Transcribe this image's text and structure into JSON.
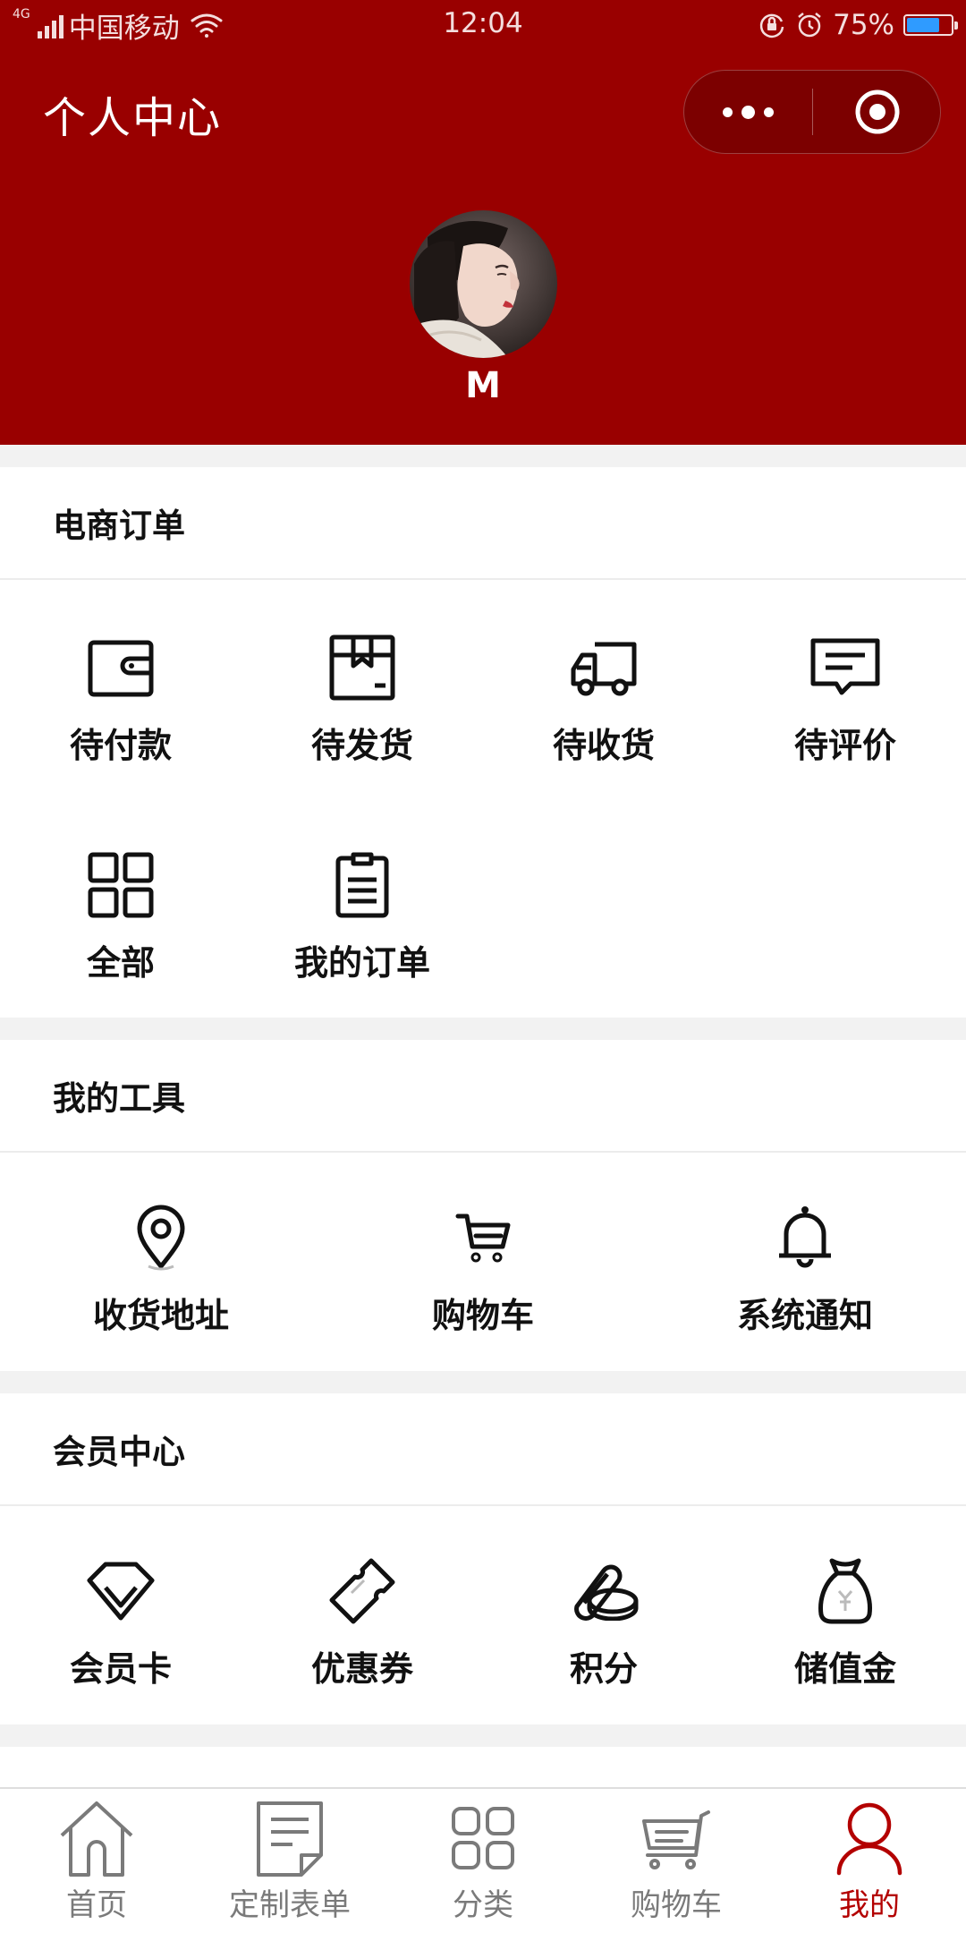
{
  "status_bar": {
    "network": "4G",
    "carrier": "中国移动",
    "time": "12:04",
    "battery": "75%",
    "battery_level": 0.75,
    "battery_color": "#2f9bff"
  },
  "header": {
    "title": "个人中心",
    "username": "M",
    "background_color": "#990000",
    "more_icon": "more-dots-icon",
    "close_icon": "target-circle-icon"
  },
  "orders": {
    "title": "电商订单",
    "items": [
      {
        "label": "待付款",
        "icon": "wallet-icon"
      },
      {
        "label": "待发货",
        "icon": "package-box-icon"
      },
      {
        "label": "待收货",
        "icon": "delivery-truck-icon"
      },
      {
        "label": "待评价",
        "icon": "comment-icon"
      },
      {
        "label": "全部",
        "icon": "grid-icon"
      },
      {
        "label": "我的订单",
        "icon": "clipboard-list-icon"
      }
    ]
  },
  "tools": {
    "title": "我的工具",
    "items": [
      {
        "label": "收货地址",
        "icon": "location-pin-icon"
      },
      {
        "label": "购物车",
        "icon": "shopping-cart-icon"
      },
      {
        "label": "系统通知",
        "icon": "bell-icon"
      }
    ]
  },
  "member": {
    "title": "会员中心",
    "items": [
      {
        "label": "会员卡",
        "icon": "diamond-icon"
      },
      {
        "label": "优惠券",
        "icon": "coupon-ticket-icon"
      },
      {
        "label": "积分",
        "icon": "coins-icon"
      },
      {
        "label": "储值金",
        "icon": "money-bag-icon"
      }
    ]
  },
  "tabbar": {
    "active_color": "#b30000",
    "items": [
      {
        "label": "首页",
        "icon": "home-icon",
        "active": false
      },
      {
        "label": "定制表单",
        "icon": "form-document-icon",
        "active": false
      },
      {
        "label": "分类",
        "icon": "category-grid-icon",
        "active": false
      },
      {
        "label": "购物车",
        "icon": "cart-icon",
        "active": false
      },
      {
        "label": "我的",
        "icon": "user-icon",
        "active": true
      }
    ]
  }
}
